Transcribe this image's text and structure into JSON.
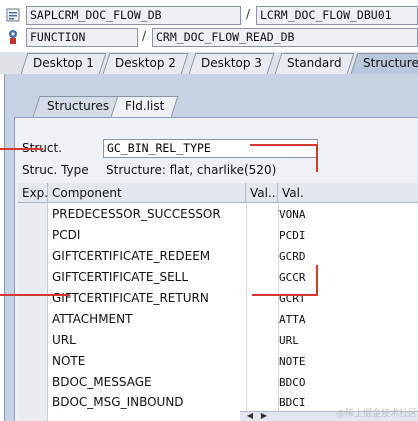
{
  "program": {
    "main_program": "SAPLCRM_DOC_FLOW_DB",
    "include": "LCRM_DOC_FLOW_DBU01",
    "type": "FUNCTION",
    "name": "CRM_DOC_FLOW_READ_DB",
    "separator": "/"
  },
  "tabs": [
    "Desktop 1",
    "Desktop 2",
    "Desktop 3",
    "Standard",
    "Structures"
  ],
  "subtabs": [
    "Structures",
    "Fld.list"
  ],
  "struct": {
    "label": "Struct.",
    "value": "GC_BIN_REL_TYPE",
    "type_label": "Struc. Type",
    "type_value": "Structure: flat, charlike(520)"
  },
  "table": {
    "headers": [
      "Exp.",
      "Component",
      "Val...",
      "Val."
    ],
    "rows": [
      {
        "component": "PREDECESSOR_SUCCESSOR",
        "value": "VONA"
      },
      {
        "component": "PCDI",
        "value": "PCDI"
      },
      {
        "component": "GIFTCERTIFICATE_REDEEM",
        "value": "GCRD"
      },
      {
        "component": "GIFTCERTIFICATE_SELL",
        "value": "GCCR"
      },
      {
        "component": "GIFTCERTIFICATE_RETURN",
        "value": "GCRT"
      },
      {
        "component": "ATTACHMENT",
        "value": "ATTA"
      },
      {
        "component": "URL",
        "value": "URL"
      },
      {
        "component": "NOTE",
        "value": "NOTE"
      },
      {
        "component": "BDOC_MESSAGE",
        "value": "BDCO"
      },
      {
        "component": "BDOC_MSG_INBOUND",
        "value": "BDCI"
      }
    ]
  },
  "scroll": {
    "left_icon": "arrow-left-icon",
    "right_icon": "arrow-right-icon"
  },
  "watermark": "@稀土掘金技术社区",
  "colors": {
    "annotation": "#d63a2f",
    "tab_active": "#b8c7dc",
    "panel": "#c7d3e3"
  }
}
